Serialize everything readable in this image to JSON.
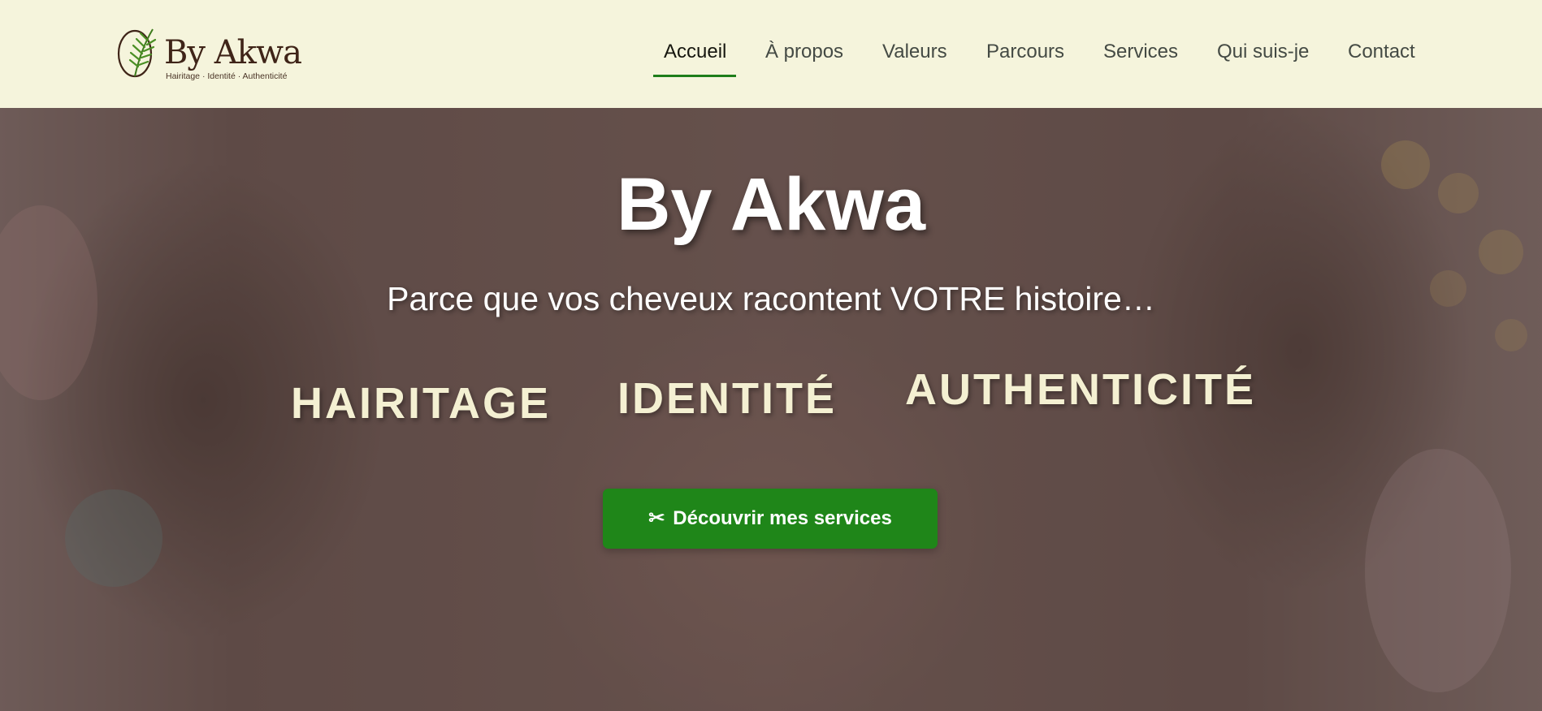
{
  "brand": {
    "name": "By Akwa",
    "tagline": "Hairitage · Identité · Authenticité",
    "logo_icon": "palm-leaf-icon",
    "accent_color": "#1f8619",
    "brand_text_color": "#3f2418",
    "header_bg": "#f5f4dc"
  },
  "nav": {
    "items": [
      {
        "label": "Accueil",
        "active": true
      },
      {
        "label": "À propos",
        "active": false
      },
      {
        "label": "Valeurs",
        "active": false
      },
      {
        "label": "Parcours",
        "active": false
      },
      {
        "label": "Services",
        "active": false
      },
      {
        "label": "Qui suis-je",
        "active": false
      },
      {
        "label": "Contact",
        "active": false
      }
    ]
  },
  "hero": {
    "title": "By Akwa",
    "subtitle": "Parce que vos cheveux racontent VOTRE histoire…",
    "pillars": [
      "HAIRITAGE",
      "IDENTITÉ",
      "AUTHENTICITÉ"
    ],
    "cta": {
      "label": "Découvrir mes services",
      "icon": "scissors-icon"
    }
  }
}
